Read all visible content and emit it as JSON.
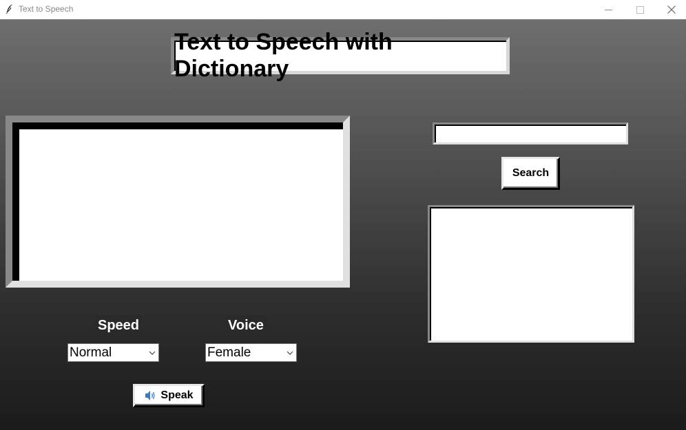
{
  "window": {
    "title": "Text to Speech"
  },
  "app": {
    "heading": "Text to Speech with Dictionary"
  },
  "input": {
    "text_value": "",
    "dictionary_value": ""
  },
  "dictionary": {
    "search_label": "Search",
    "result_text": ""
  },
  "options": {
    "speed_label": "Speed",
    "speed_value": "Normal",
    "voice_label": "Voice",
    "voice_value": "Female"
  },
  "actions": {
    "speak_label": "Speak"
  },
  "icons": {
    "app": "feather-icon",
    "speak": "speaker-icon",
    "minimize": "minimize-icon",
    "maximize": "maximize-icon",
    "close": "close-icon",
    "dropdown": "chevron-down-icon"
  },
  "colors": {
    "panel_light": "#ffffff",
    "background_top": "#6f6f6f",
    "background_bottom": "#1b1b1b",
    "label_bg": "#2a2a2a",
    "speaker_blue": "#3a78c8"
  }
}
